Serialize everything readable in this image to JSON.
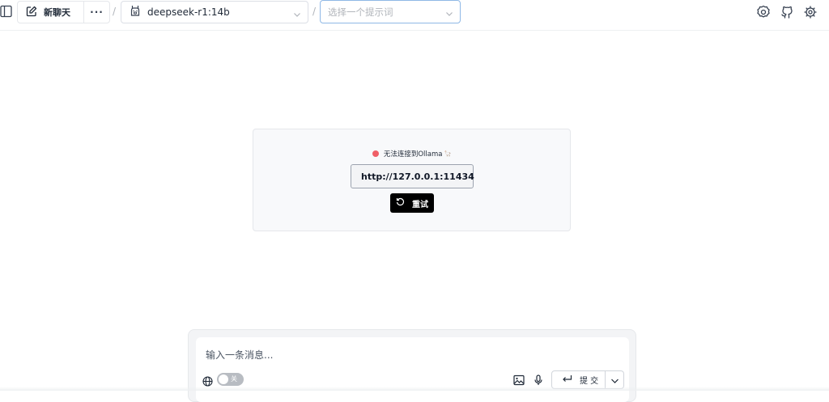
{
  "header": {
    "new_chat_label": "新聊天",
    "more_label": "···",
    "separator": "/",
    "model_select": {
      "value": "deepseek-r1:14b"
    },
    "prompt_select": {
      "placeholder": "选择一个提示词"
    }
  },
  "connection": {
    "status_text": "无法连接到Ollama",
    "status_emoji": "🦙",
    "status_color": "#ef5f67",
    "url_value": "http://127.0.0.1:11434",
    "retry_label": "重试"
  },
  "composer": {
    "placeholder": "输入一条消息...",
    "web_toggle_label": "关",
    "submit_label": "提 交"
  },
  "icons": {
    "sidebar": "sidebar-toggle-icon",
    "new_chat": "edit-icon",
    "model": "llama-icon",
    "settings": "settings-icon",
    "github": "github-icon",
    "gear": "gear-icon",
    "retry": "refresh-icon",
    "web": "globe-icon",
    "image": "image-icon",
    "mic": "microphone-icon",
    "enter": "enter-icon",
    "dropdown": "chevron-down-icon"
  }
}
